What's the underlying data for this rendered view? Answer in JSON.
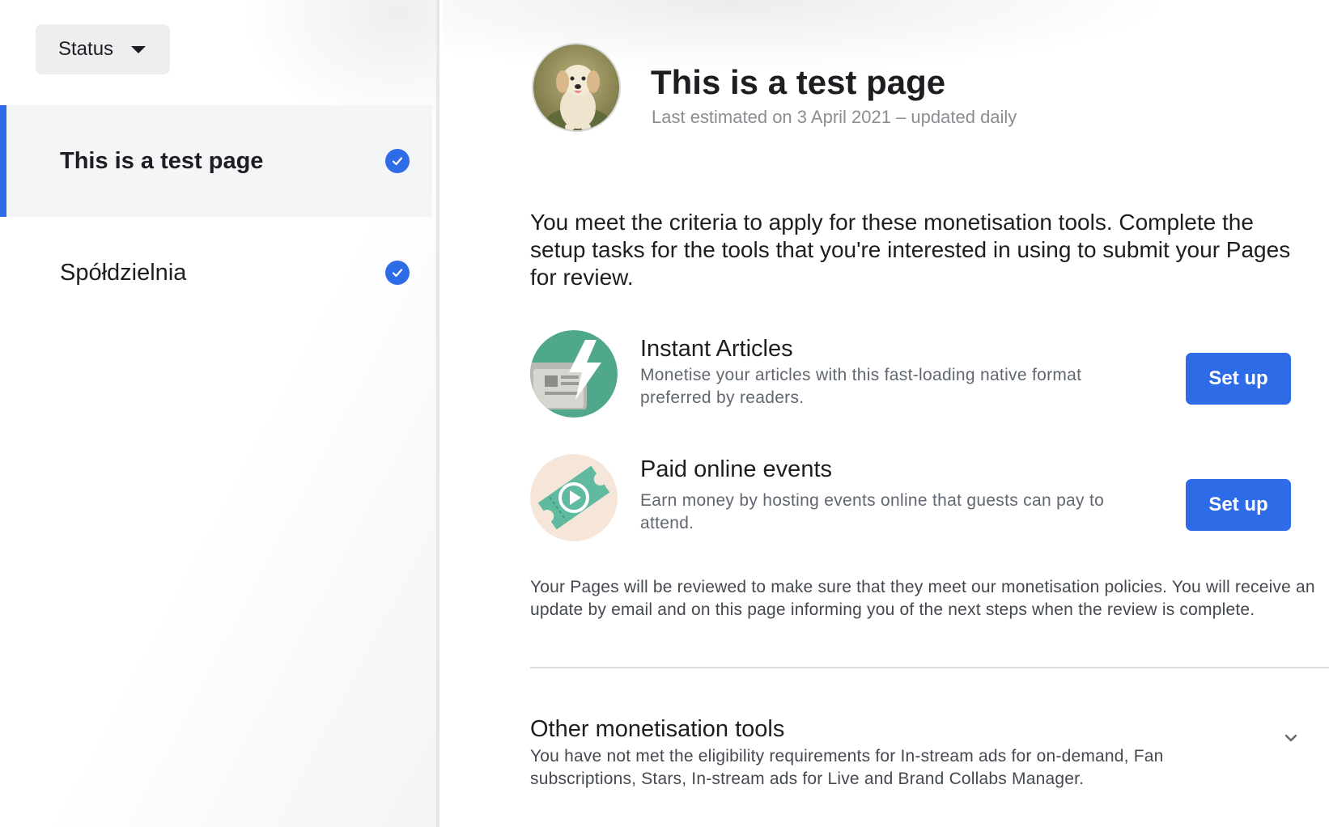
{
  "sidebar": {
    "status_label": "Status",
    "items": [
      {
        "label": "This is a test page",
        "active": true
      },
      {
        "label": "Spółdzielnia",
        "active": false
      }
    ]
  },
  "header": {
    "page_title": "This is a test page",
    "subtitle": "Last estimated on 3 April 2021 – updated daily"
  },
  "main": {
    "criteria_text": "You meet the criteria to apply for these monetisation tools. Complete the setup tasks for the tools that you're interested in using to submit your Pages for review.",
    "tools": [
      {
        "title": "Instant Articles",
        "description": "Monetise your articles with this fast-loading native format preferred by readers.",
        "button_label": "Set up",
        "icon": "instant-articles-icon"
      },
      {
        "title": "Paid online events",
        "description": "Earn money by hosting events online that guests can pay to attend.",
        "button_label": "Set up",
        "icon": "paid-events-ticket-icon"
      }
    ],
    "review_note": "Your Pages will be reviewed to make sure that they meet our monetisation policies. You will receive an update by email and on this page informing you of the next steps when the review is complete.",
    "other_tools": {
      "title": "Other monetisation tools",
      "description": "You have not met the eligibility requirements for In-stream ads for on-demand, Fan subscriptions, Stars, In-stream ads for Live and Brand Collabs Manager."
    }
  },
  "colors": {
    "accent": "#2e6be6",
    "sidebar_active_bg": "#f4f5f6",
    "muted_text": "#8a8d91"
  }
}
